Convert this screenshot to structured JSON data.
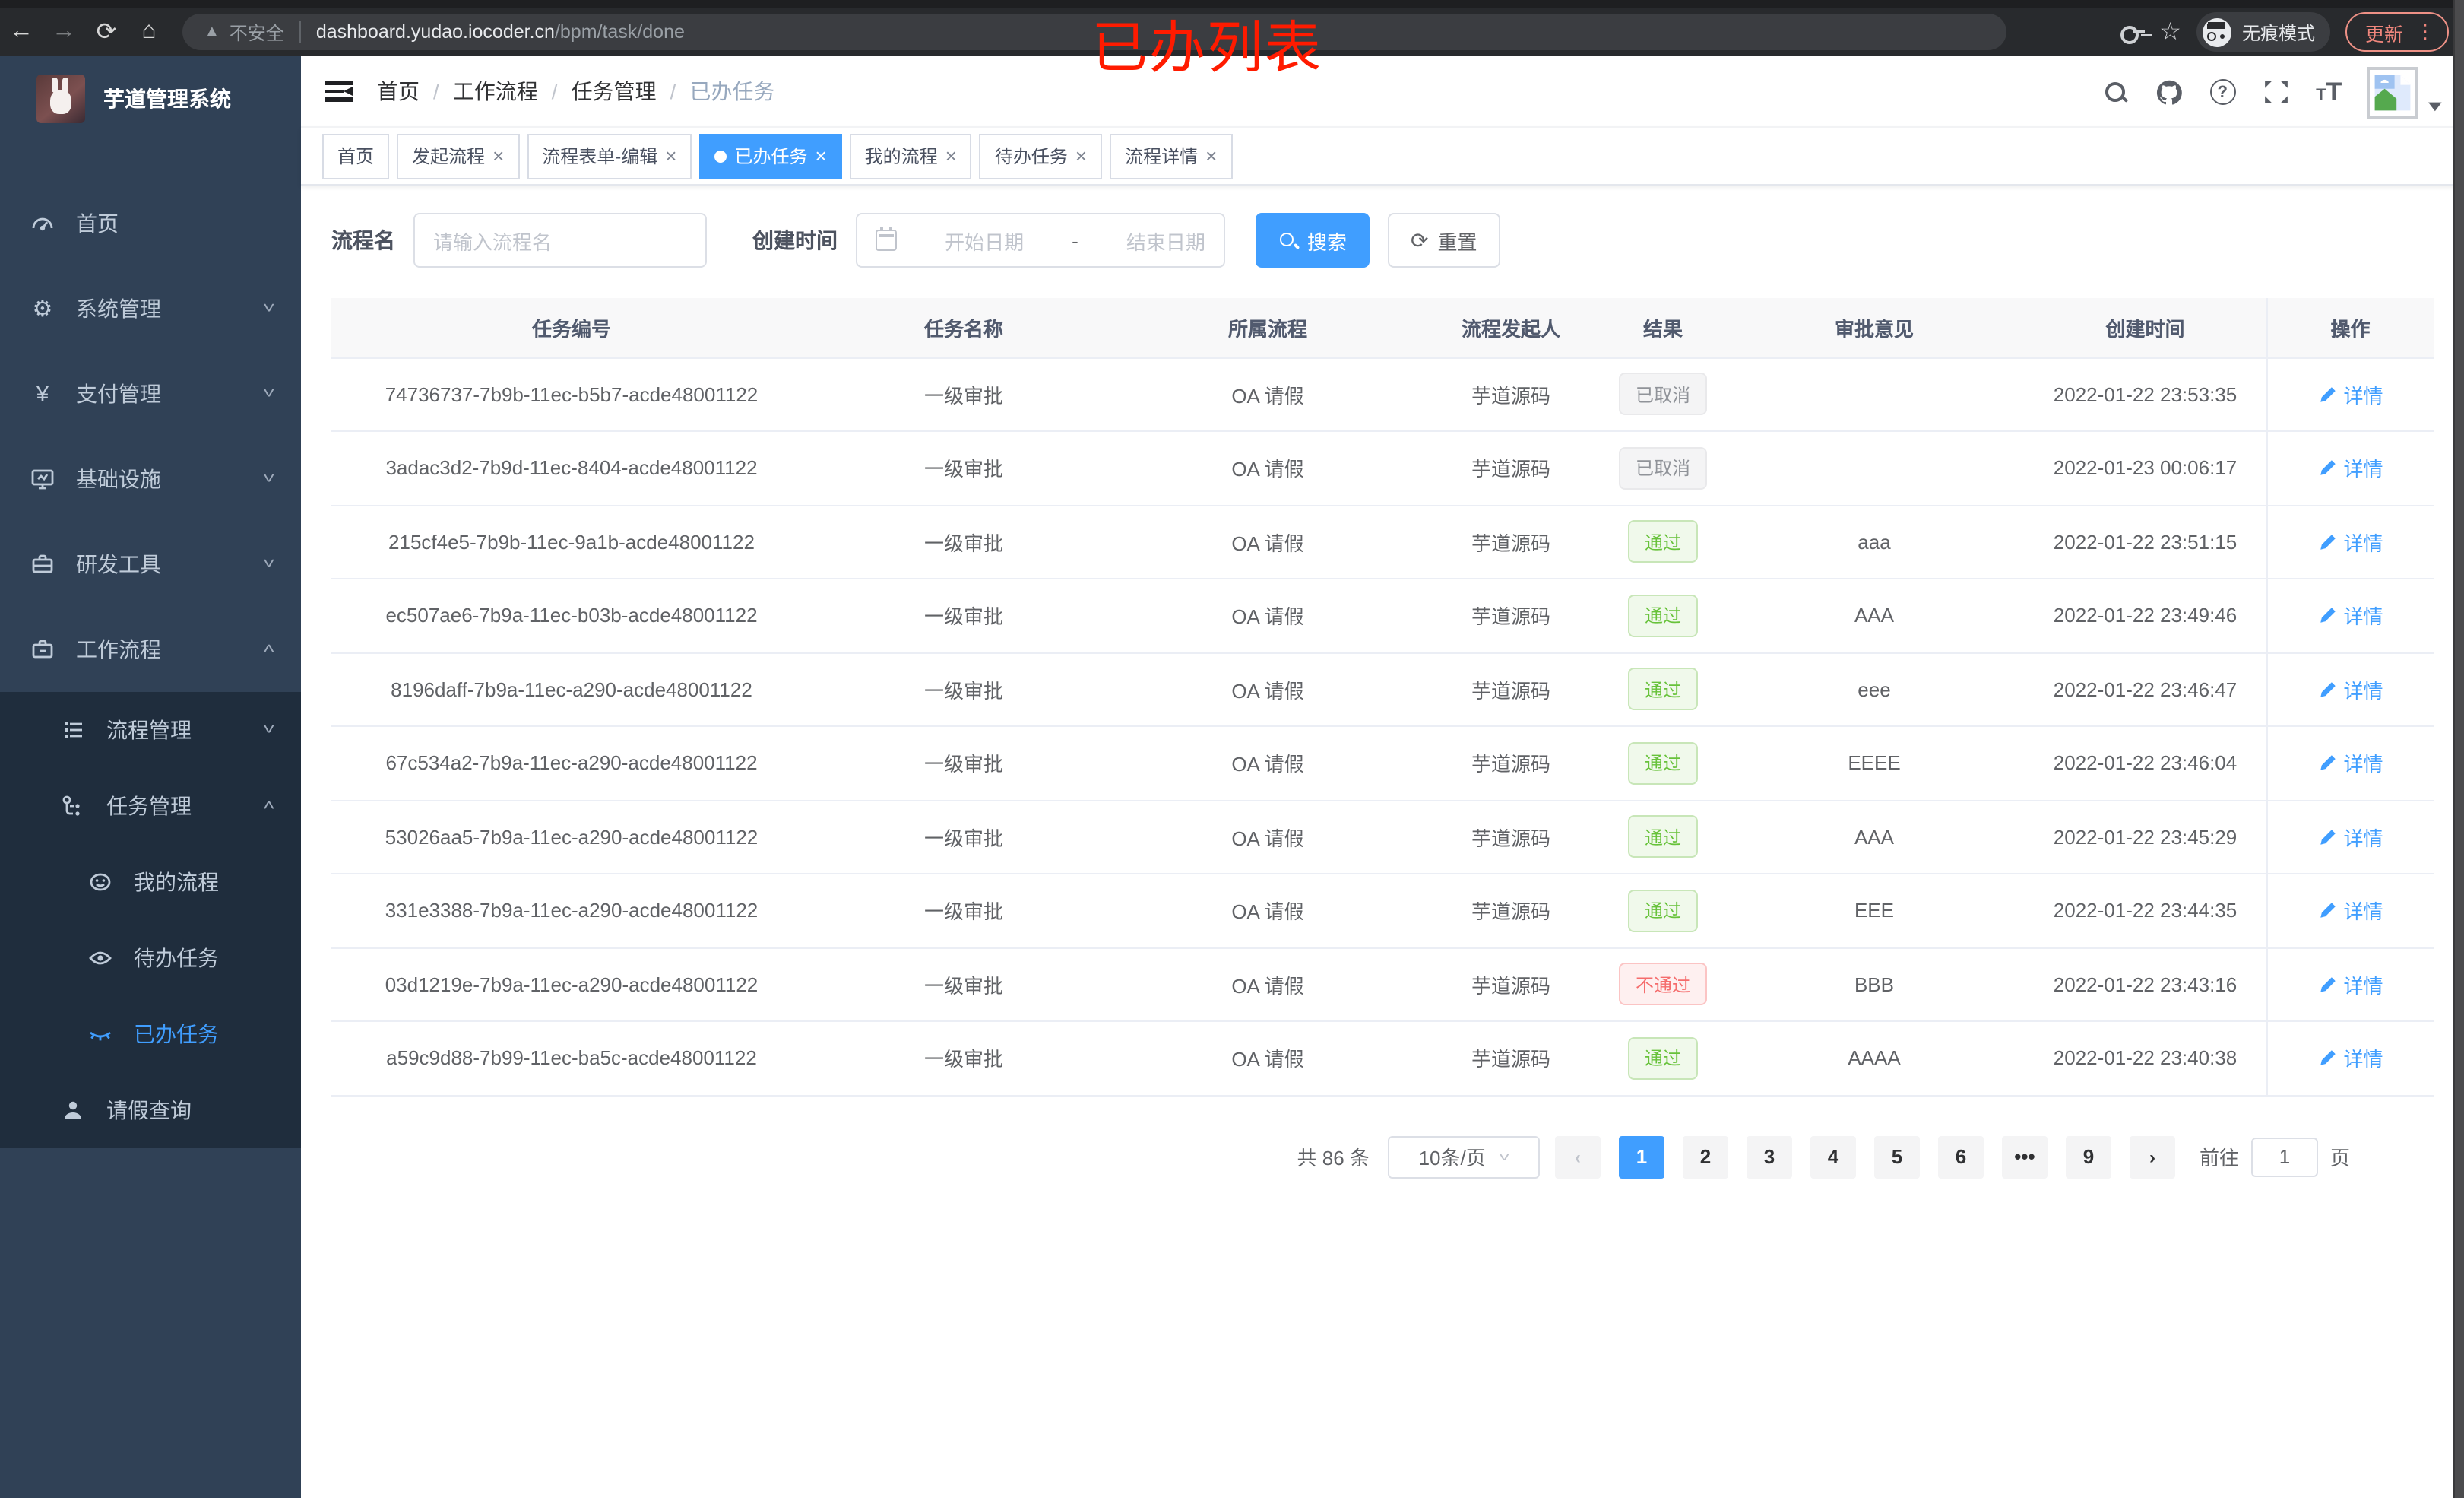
{
  "browser": {
    "security_label": "不安全",
    "url_host": "dashboard.yudao.iocoder.cn",
    "url_path": "/bpm/task/done",
    "incognito_label": "无痕模式",
    "update_label": "更新"
  },
  "annotation": {
    "text": "已办列表",
    "color": "#ff1b00"
  },
  "sidebar": {
    "title": "芋道管理系统",
    "menu": [
      {
        "label": "首页",
        "icon": "dashboard-icon"
      },
      {
        "label": "系统管理",
        "icon": "gear-icon"
      },
      {
        "label": "支付管理",
        "icon": "yen-icon"
      },
      {
        "label": "基础设施",
        "icon": "monitor-icon"
      },
      {
        "label": "研发工具",
        "icon": "toolbox-icon"
      },
      {
        "label": "工作流程",
        "icon": "briefcase-icon"
      },
      {
        "label": "流程管理",
        "icon": "list-icon"
      },
      {
        "label": "任务管理",
        "icon": "flow-icon"
      },
      {
        "label": "我的流程",
        "icon": "face-icon"
      },
      {
        "label": "待办任务",
        "icon": "eye-open-icon"
      },
      {
        "label": "已办任务",
        "icon": "eye-closed-icon"
      },
      {
        "label": "请假查询",
        "icon": "user-icon"
      }
    ]
  },
  "breadcrumb": {
    "items": [
      "首页",
      "工作流程",
      "任务管理",
      "已办任务"
    ]
  },
  "tabs": [
    {
      "label": "首页"
    },
    {
      "label": "发起流程"
    },
    {
      "label": "流程表单-编辑"
    },
    {
      "label": "已办任务"
    },
    {
      "label": "我的流程"
    },
    {
      "label": "待办任务"
    },
    {
      "label": "流程详情"
    }
  ],
  "search": {
    "name_label": "流程名",
    "name_placeholder": "请输入流程名",
    "time_label": "创建时间",
    "start_placeholder": "开始日期",
    "range_separator": "-",
    "end_placeholder": "结束日期",
    "search_label": "搜索",
    "reset_label": "重置"
  },
  "table": {
    "headers": [
      "任务编号",
      "任务名称",
      "所属流程",
      "流程发起人",
      "结果",
      "审批意见",
      "创建时间",
      "操作"
    ],
    "action_label": "详情",
    "rows": [
      {
        "id": "74736737-7b9b-11ec-b5b7-acde48001122",
        "name": "一级审批",
        "process": "OA 请假",
        "starter": "芋道源码",
        "result": "已取消",
        "result_class": "tag tag-info",
        "opinion": "",
        "time": "2022-01-22 23:53:35"
      },
      {
        "id": "3adac3d2-7b9d-11ec-8404-acde48001122",
        "name": "一级审批",
        "process": "OA 请假",
        "starter": "芋道源码",
        "result": "已取消",
        "result_class": "tag tag-info",
        "opinion": "",
        "time": "2022-01-23 00:06:17"
      },
      {
        "id": "215cf4e5-7b9b-11ec-9a1b-acde48001122",
        "name": "一级审批",
        "process": "OA 请假",
        "starter": "芋道源码",
        "result": "通过",
        "result_class": "tag tag-success",
        "opinion": "aaa",
        "time": "2022-01-22 23:51:15"
      },
      {
        "id": "ec507ae6-7b9a-11ec-b03b-acde48001122",
        "name": "一级审批",
        "process": "OA 请假",
        "starter": "芋道源码",
        "result": "通过",
        "result_class": "tag tag-success",
        "opinion": "AAA",
        "time": "2022-01-22 23:49:46"
      },
      {
        "id": "8196daff-7b9a-11ec-a290-acde48001122",
        "name": "一级审批",
        "process": "OA 请假",
        "starter": "芋道源码",
        "result": "通过",
        "result_class": "tag tag-success",
        "opinion": "eee",
        "time": "2022-01-22 23:46:47"
      },
      {
        "id": "67c534a2-7b9a-11ec-a290-acde48001122",
        "name": "一级审批",
        "process": "OA 请假",
        "starter": "芋道源码",
        "result": "通过",
        "result_class": "tag tag-success",
        "opinion": "EEEE",
        "time": "2022-01-22 23:46:04"
      },
      {
        "id": "53026aa5-7b9a-11ec-a290-acde48001122",
        "name": "一级审批",
        "process": "OA 请假",
        "starter": "芋道源码",
        "result": "通过",
        "result_class": "tag tag-success",
        "opinion": "AAA",
        "time": "2022-01-22 23:45:29"
      },
      {
        "id": "331e3388-7b9a-11ec-a290-acde48001122",
        "name": "一级审批",
        "process": "OA 请假",
        "starter": "芋道源码",
        "result": "通过",
        "result_class": "tag tag-success",
        "opinion": "EEE",
        "time": "2022-01-22 23:44:35"
      },
      {
        "id": "03d1219e-7b9a-11ec-a290-acde48001122",
        "name": "一级审批",
        "process": "OA 请假",
        "starter": "芋道源码",
        "result": "不通过",
        "result_class": "tag tag-danger",
        "opinion": "BBB",
        "time": "2022-01-22 23:43:16"
      },
      {
        "id": "a59c9d88-7b99-11ec-ba5c-acde48001122",
        "name": "一级审批",
        "process": "OA 请假",
        "starter": "芋道源码",
        "result": "通过",
        "result_class": "tag tag-success",
        "opinion": "AAAA",
        "time": "2022-01-22 23:40:38"
      }
    ]
  },
  "pagination": {
    "total_label": "共 86 条",
    "page_size": "10条/页",
    "pages": [
      "1",
      "2",
      "3",
      "4",
      "5",
      "6",
      "•••",
      "9"
    ],
    "jump_prefix": "前往",
    "jump_value": "1",
    "jump_suffix": "页"
  },
  "colors": {
    "accent": "#409eff",
    "success": "#67c23a",
    "danger": "#f56c6c",
    "info": "#909399",
    "sidebar_bg": "#304156",
    "submenu_bg": "#1f2d3d"
  }
}
